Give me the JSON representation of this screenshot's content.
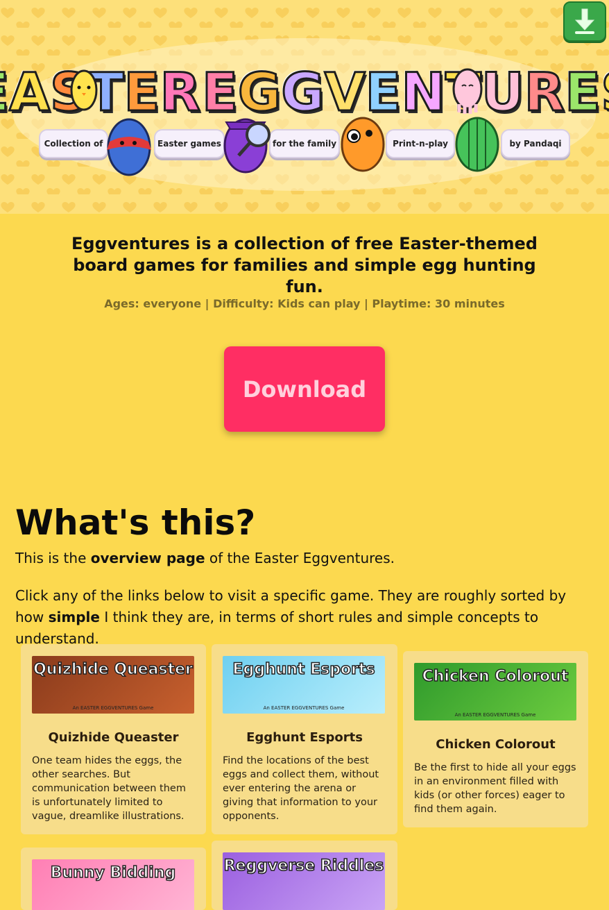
{
  "header": {
    "logo_letters": [
      "E",
      "A",
      "S",
      "T",
      "E",
      "R",
      " ",
      "E",
      "G",
      "G",
      "V",
      "E",
      "N",
      "T",
      "U",
      "R",
      "E",
      "S"
    ],
    "logo_colors": [
      "#9be56a",
      "#ffe04d",
      "#ff8a3d",
      "#8fb0ff",
      "#ff9a3c",
      "#ff78b8",
      "",
      "#ff7fa8",
      "#f7b63c",
      "#c9a8ff",
      "#ffe06b",
      "#8fd0ff",
      "#f6a7ff",
      "#ffdf4d",
      "#ffc0d8",
      "#ff8a8a",
      "#9be56a",
      "#ffe04d"
    ],
    "ribbon": [
      "Collection of",
      "Easter games",
      "for the family",
      "Print-n-play",
      "by Pandaqi"
    ],
    "download_icon": "download-arrow-icon"
  },
  "intro": {
    "tagline": "Eggventures is a collection of free Easter-themed board games for families and simple egg hunting fun.",
    "meta": "Ages: everyone | Difficulty: Kids can play | Playtime: 30 minutes",
    "download_label": "Download"
  },
  "about": {
    "heading": "What's this?",
    "p1_pre": "This is the ",
    "p1_bold": "overview page",
    "p1_post": " of the Easter Eggventures.",
    "p2_pre": "Click any of the links below to visit a specific game. They are roughly sorted by how ",
    "p2_bold": "simple",
    "p2_post": " I think they are, in terms of short rules and simple concepts to understand."
  },
  "games": [
    {
      "title": "Quizhide Queaster",
      "thumb_title": "Quizhide Queaster",
      "thumb_sub": "An EASTER EGGVENTURES Game",
      "desc": "One team hides the eggs, the other searches. But communication between them is unfortunately limited to vague, dreamlike illustrations.",
      "colors": [
        "#8a3b1c",
        "#c8602e"
      ]
    },
    {
      "title": "Egghunt Esports",
      "thumb_title": "Egghunt Esports",
      "thumb_sub": "An EASTER EGGVENTURES Game",
      "desc": "Find the locations of the best eggs and collect them, without ever entering the arena or giving that information to your opponents.",
      "colors": [
        "#6fd0f0",
        "#b9eefc"
      ]
    },
    {
      "title": "Chicken Colorout",
      "thumb_title": "Chicken Colorout",
      "thumb_sub": "An EASTER EGGVENTURES Game",
      "desc": "Be the first to hide all your eggs in an environment filled with kids (or other forces) eager to find them again.",
      "colors": [
        "#2f9a2c",
        "#6dcc3f"
      ]
    },
    {
      "title": "",
      "thumb_title": "Bunny Bidding",
      "thumb_sub": "",
      "desc": "",
      "colors": [
        "#ff7fb4",
        "#ffb6d5"
      ]
    },
    {
      "title": "",
      "thumb_title": "Reggverse Riddles",
      "thumb_sub": "",
      "desc": "",
      "colors": [
        "#9b5fe0",
        "#c9a4f5"
      ]
    }
  ]
}
